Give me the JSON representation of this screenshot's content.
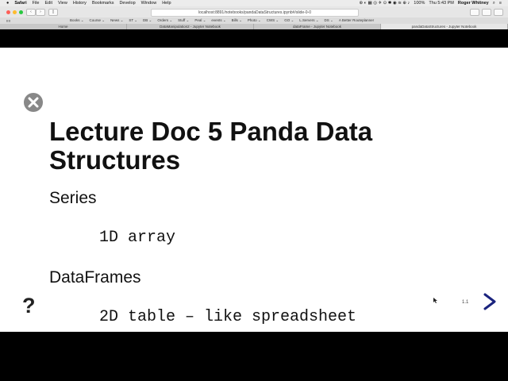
{
  "menubar": {
    "apple": "",
    "app": "Safari",
    "items": [
      "File",
      "Edit",
      "View",
      "History",
      "Bookmarks",
      "Develop",
      "Window",
      "Help"
    ],
    "battery": "100%",
    "clock": "Thu 5:43 PM",
    "user": "Roger Whitney"
  },
  "toolbar": {
    "url": "localhost:8891/notebooks/pandaDataStructures.ipynb#/slide-0-0"
  },
  "bookmarks": {
    "left": "!!!!",
    "items": [
      "Books ⌄",
      "Course ⌄",
      "News ⌄",
      "ST ⌄",
      "DB ⌄",
      "Orders ⌄",
      "Stuff ⌄",
      "Peal ⌄",
      "events ⌄",
      "Bills ⌄",
      "Photo ⌄",
      "CWS ⌄",
      "GO ⌄",
      "L.Servers ⌄",
      "DS ⌄",
      "A Better Routeplanner"
    ]
  },
  "tabs": [
    {
      "label": "Home",
      "active": false
    },
    {
      "label": "DataManipulation2 - Jupyter Notebook",
      "active": false
    },
    {
      "label": "dataFrame - Jupyter Notebook",
      "active": false
    },
    {
      "label": "pandaDataStructures - Jupyter Notebook",
      "active": true
    }
  ],
  "slide": {
    "title": "Lecture Doc 5 Panda Data Structures",
    "sections": [
      {
        "heading": "Series",
        "code": "1D array"
      },
      {
        "heading": "DataFrames",
        "code": "2D table – like spreadsheet"
      }
    ],
    "help": "?",
    "slide_number": "1.1"
  },
  "colors": {
    "accent_arrow": "#1a237e",
    "close_icon": "#888888"
  }
}
